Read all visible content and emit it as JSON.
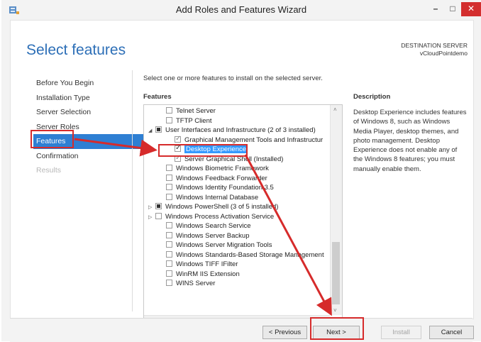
{
  "window": {
    "title": "Add Roles and Features Wizard",
    "minimize_glyph": "–",
    "maximize_glyph": "□",
    "close_glyph": "✕"
  },
  "page": {
    "title": "Select features",
    "destination_label": "DESTINATION SERVER",
    "destination_server": "vCloudPointdemo",
    "instruction": "Select one or more features to install on the selected server.",
    "features_label": "Features",
    "description_label": "Description",
    "description_text": "Desktop Experience includes features of Windows 8, such as Windows Media Player, desktop themes, and photo management. Desktop Experience does not enable any of the Windows 8 features; you must manually enable them."
  },
  "nav": {
    "items": [
      {
        "label": "Before You Begin",
        "state": "normal"
      },
      {
        "label": "Installation Type",
        "state": "normal"
      },
      {
        "label": "Server Selection",
        "state": "normal"
      },
      {
        "label": "Server Roles",
        "state": "normal"
      },
      {
        "label": "Features",
        "state": "active"
      },
      {
        "label": "Confirmation",
        "state": "normal"
      },
      {
        "label": "Results",
        "state": "disabled"
      }
    ]
  },
  "features": [
    {
      "label": "Telnet Server",
      "indent": 1,
      "check": "none",
      "expander": ""
    },
    {
      "label": "TFTP Client",
      "indent": 1,
      "check": "none",
      "expander": ""
    },
    {
      "label": "User Interfaces and Infrastructure (2 of 3 installed)",
      "indent": 0,
      "check": "partial",
      "expander": "◢"
    },
    {
      "label": "Graphical Management Tools and Infrastructur",
      "indent": 2,
      "check": "installed",
      "expander": ""
    },
    {
      "label": "Desktop Experience",
      "indent": 2,
      "check": "checked",
      "expander": "",
      "selected": true
    },
    {
      "label": "Server Graphical Shell (Installed)",
      "indent": 2,
      "check": "installed",
      "expander": ""
    },
    {
      "label": "Windows Biometric Framework",
      "indent": 1,
      "check": "none",
      "expander": ""
    },
    {
      "label": "Windows Feedback Forwarder",
      "indent": 1,
      "check": "none",
      "expander": ""
    },
    {
      "label": "Windows Identity Foundation 3.5",
      "indent": 1,
      "check": "none",
      "expander": ""
    },
    {
      "label": "Windows Internal Database",
      "indent": 1,
      "check": "none",
      "expander": ""
    },
    {
      "label": "Windows PowerShell (3 of 5 installed)",
      "indent": 0,
      "check": "partial",
      "expander": "▷"
    },
    {
      "label": "Windows Process Activation Service",
      "indent": 0,
      "check": "none",
      "expander": "▷"
    },
    {
      "label": "Windows Search Service",
      "indent": 1,
      "check": "none",
      "expander": ""
    },
    {
      "label": "Windows Server Backup",
      "indent": 1,
      "check": "none",
      "expander": ""
    },
    {
      "label": "Windows Server Migration Tools",
      "indent": 1,
      "check": "none",
      "expander": ""
    },
    {
      "label": "Windows Standards-Based Storage Management",
      "indent": 1,
      "check": "none",
      "expander": ""
    },
    {
      "label": "Windows TIFF IFilter",
      "indent": 1,
      "check": "none",
      "expander": ""
    },
    {
      "label": "WinRM IIS Extension",
      "indent": 1,
      "check": "none",
      "expander": ""
    },
    {
      "label": "WINS Server",
      "indent": 1,
      "check": "none",
      "expander": ""
    }
  ],
  "scroll": {
    "up_glyph": "˄",
    "down_glyph": "˅",
    "left_glyph": "<",
    "right_glyph": ">"
  },
  "buttons": {
    "previous": "< Previous",
    "next": "Next >",
    "install": "Install",
    "cancel": "Cancel"
  },
  "colors": {
    "accent": "#2e7fd3",
    "title": "#2d6fb7",
    "annotation": "#d62b2b",
    "close": "#d32f2f"
  }
}
